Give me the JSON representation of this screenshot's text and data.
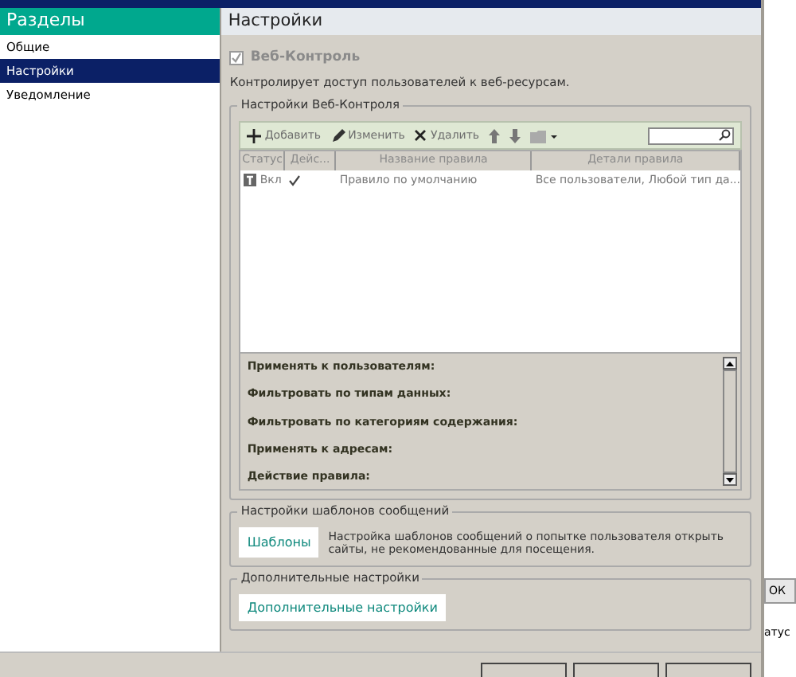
{
  "sidebar": {
    "title": "Разделы",
    "items": [
      {
        "label": "Общие",
        "selected": false
      },
      {
        "label": "Настройки",
        "selected": true
      },
      {
        "label": "Уведомление",
        "selected": false
      }
    ]
  },
  "panel": {
    "title": "Настройки",
    "enable": {
      "label": "Веб-Контроль",
      "checked": true,
      "disabled": true
    },
    "description": "Контролирует доступ пользователей к веб-ресурсам.",
    "rules_group": {
      "title": "Настройки Веб-Контроля",
      "toolbar": [
        {
          "kind": "add",
          "label": "Добавить"
        },
        {
          "kind": "edit",
          "label": "Изменить"
        },
        {
          "kind": "delete",
          "label": "Удалить"
        },
        {
          "kind": "up"
        },
        {
          "kind": "down"
        },
        {
          "kind": "folder"
        }
      ],
      "columns": [
        "Статус",
        "Дейс...",
        "Название правила",
        "Детали правила"
      ],
      "rows": [
        {
          "status": "Вкл",
          "checked": true,
          "name": "Правило по умолчанию",
          "details": "Все пользователи, Любой тип да...",
          "selected": false
        }
      ],
      "details": [
        "Применять к пользователям:",
        "Фильтровать по типам данных:",
        "Фильтровать по категориям содержания:",
        "Применять к адресам:",
        "Действие правила:"
      ]
    },
    "templates_group": {
      "title": "Настройки шаблонов сообщений",
      "button": "Шаблоны",
      "text": "Настройка шаблонов сообщений о попытке пользователя открыть сайты, не рекомендованные для посещения."
    },
    "advanced_group": {
      "title": "Дополнительные настройки",
      "button": "Дополнительные настройки"
    }
  },
  "background_window": {
    "button": "ОК",
    "text": "атус"
  }
}
